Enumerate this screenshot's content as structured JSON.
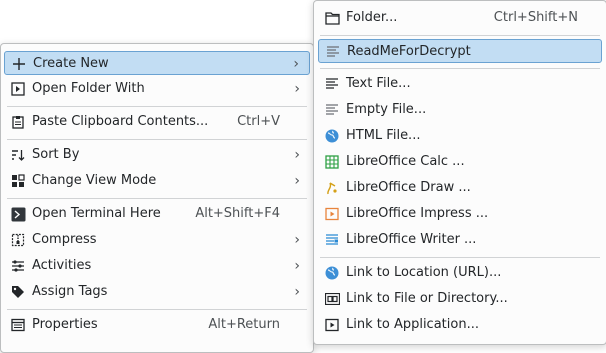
{
  "main_menu": {
    "create_new": "Create New",
    "open_folder_with": "Open Folder With",
    "paste_clipboard": "Paste Clipboard Contents...",
    "paste_shortcut": "Ctrl+V",
    "sort_by": "Sort By",
    "change_view_mode": "Change View Mode",
    "open_terminal": "Open Terminal Here",
    "open_terminal_shortcut": "Alt+Shift+F4",
    "compress": "Compress",
    "activities": "Activities",
    "assign_tags": "Assign Tags",
    "properties": "Properties",
    "properties_shortcut": "Alt+Return"
  },
  "submenu": {
    "folder": "Folder...",
    "folder_shortcut": "Ctrl+Shift+N",
    "readme": "ReadMeForDecrypt",
    "text_file": "Text File...",
    "empty_file": "Empty File...",
    "html_file": "HTML File...",
    "calc": "LibreOffice Calc  ...",
    "draw": "LibreOffice Draw  ...",
    "impress": "LibreOffice Impress  ...",
    "writer": "LibreOffice Writer  ...",
    "link_url": "Link to Location (URL)...",
    "link_file": "Link to File or Directory...",
    "link_app": "Link to Application..."
  },
  "arrow_glyph": "›",
  "colors": {
    "highlight_bg": "#c2ddf3",
    "highlight_border": "#6aa2d2",
    "menu_bg": "#fcfcfc",
    "text": "#232629",
    "calc_green": "#2ea043",
    "draw_yellow": "#d4a017",
    "impress_orange": "#e8843c",
    "writer_blue": "#2a8ad4",
    "html_blue": "#3d8fd6"
  }
}
